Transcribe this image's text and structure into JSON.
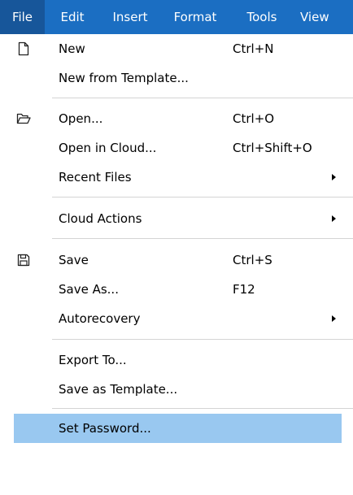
{
  "menubar": {
    "items": [
      {
        "label": "File"
      },
      {
        "label": "Edit"
      },
      {
        "label": "Insert"
      },
      {
        "label": "Format"
      },
      {
        "label": "Tools"
      },
      {
        "label": "View"
      }
    ]
  },
  "file_menu": {
    "new": {
      "label": "New",
      "shortcut": "Ctrl+N",
      "icon": "new-document-icon"
    },
    "new_template": {
      "label": "New from Template..."
    },
    "open": {
      "label": "Open...",
      "shortcut": "Ctrl+O",
      "icon": "folder-open-icon"
    },
    "open_cloud": {
      "label": "Open in Cloud...",
      "shortcut": "Ctrl+Shift+O"
    },
    "recent": {
      "label": "Recent Files",
      "submenu": true
    },
    "cloud_actions": {
      "label": "Cloud Actions",
      "submenu": true
    },
    "save": {
      "label": "Save",
      "shortcut": "Ctrl+S",
      "icon": "save-icon"
    },
    "save_as": {
      "label": "Save As...",
      "shortcut": "F12"
    },
    "autorecovery": {
      "label": "Autorecovery",
      "submenu": true
    },
    "export": {
      "label": "Export To..."
    },
    "save_template": {
      "label": "Save as Template..."
    },
    "set_password": {
      "label": "Set Password...",
      "highlighted": true
    }
  },
  "colors": {
    "menubar_bg": "#1b6ec2",
    "active_menu_bg": "#17569a",
    "highlight_bg": "#99c8f0",
    "separator": "#d4d4d4"
  }
}
